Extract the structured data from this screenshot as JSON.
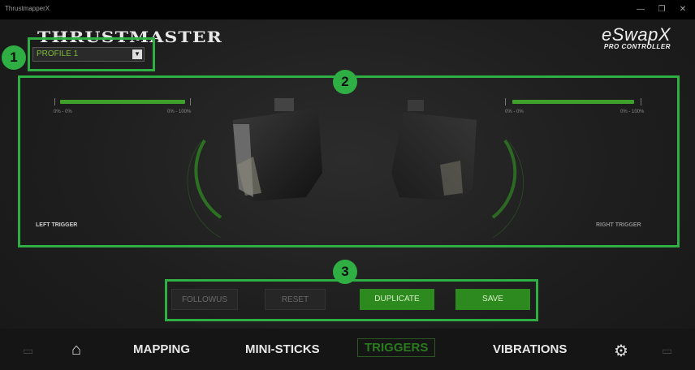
{
  "window": {
    "title": "ThrustmapperX",
    "controls": [
      "—",
      "❐",
      "✕"
    ]
  },
  "header": {
    "brand": "THRUSTMASTER",
    "profile_value": "PROFILE 1",
    "product_line1": "eSwapX",
    "product_line2": "PRO CONTROLLER"
  },
  "triggers": {
    "left": {
      "label": "LEFT TRIGGER",
      "min_label": "0% - 0%",
      "max_label": "0% - 100%",
      "level": 1.0
    },
    "right": {
      "label": "RIGHT TRIGGER",
      "min_label": "0% - 0%",
      "max_label": "0% - 100%",
      "level": 1.0
    }
  },
  "actions": {
    "buttons": [
      "FOLLOWUS",
      "RESET",
      "DUPLICATE",
      "SAVE"
    ]
  },
  "nav": {
    "items": [
      "MAPPING",
      "MINI-STICKS",
      "TRIGGERS",
      "VIBRATIONS"
    ],
    "active": "TRIGGERS"
  },
  "callouts": [
    "1",
    "2",
    "3"
  ],
  "colors": {
    "accent": "#2fae43",
    "active_green": "#2d8a1f",
    "bar_green": "#3fa12c"
  }
}
